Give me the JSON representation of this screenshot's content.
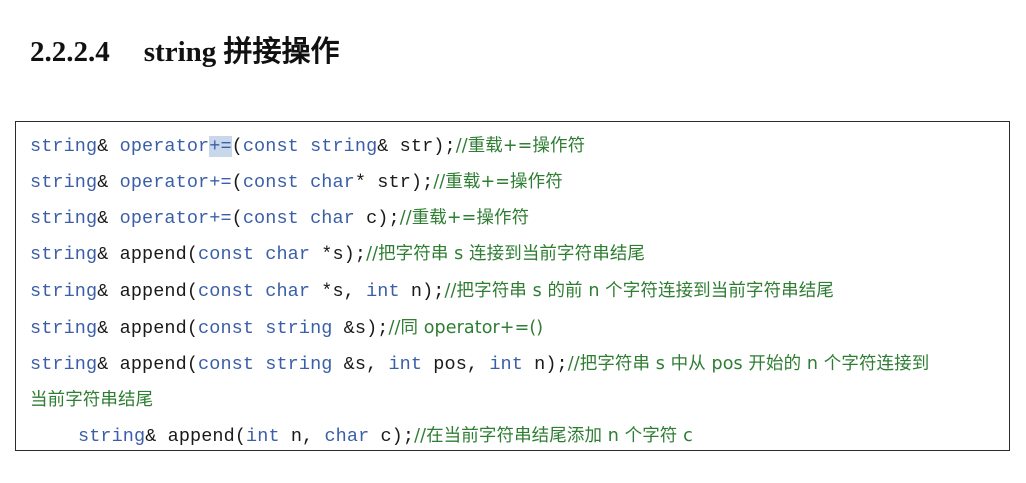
{
  "heading": {
    "number": "2.2.2.4",
    "title": "string 拼接操作"
  },
  "code": [
    {
      "t1": "string",
      "t2": "& ",
      "t3": "operator",
      "t4": "+=",
      "t5": "(",
      "t6": "const string",
      "t7": "& str);",
      "comment": "//重载+=操作符"
    },
    {
      "t1": "string",
      "t2": "& ",
      "t3": "operator",
      "t4": "+=",
      "t5": "(",
      "t6": "const char",
      "t7": "* str);",
      "comment": "//重载+=操作符"
    },
    {
      "t1": "string",
      "t2": "& ",
      "t3": "operator",
      "t4": "+=",
      "t5": "(",
      "t6": "const char",
      "t7": " c);",
      "comment": "//重载+=操作符"
    },
    {
      "t1": "string",
      "t2": "& append",
      "t3": "(",
      "t4": "const char",
      "t5": " *s);",
      "comment": "//把字符串 s 连接到当前字符串结尾"
    },
    {
      "t1": "string",
      "t2": "& append",
      "t3": "(",
      "t4": "const char",
      "t5": " *s, ",
      "t6": "int",
      "t7": " n);",
      "comment": "//把字符串 s 的前 n 个字符连接到当前字符串结尾"
    },
    {
      "t1": "string",
      "t2": "& append",
      "t3": "(",
      "t4": "const string",
      "t5": " &s);",
      "comment": "//同 operator+=()"
    },
    {
      "t1": "string",
      "t2": "& append",
      "t3": "(",
      "t4": "const string",
      "t5": " &s, ",
      "t6": "int",
      "t7": " pos, ",
      "t8": "int",
      "t9": " n);",
      "comment": "//把字符串 s 中从 pos 开始的 n 个字符连接到"
    },
    {
      "comment": "当前字符串结尾"
    },
    {
      "t1": "string",
      "t2": "& append",
      "t3": "(",
      "t4": "int",
      "t5": " n, ",
      "t6": "char",
      "t7": " c);",
      "comment": "//在当前字符串结尾添加 n 个字符 c"
    }
  ]
}
